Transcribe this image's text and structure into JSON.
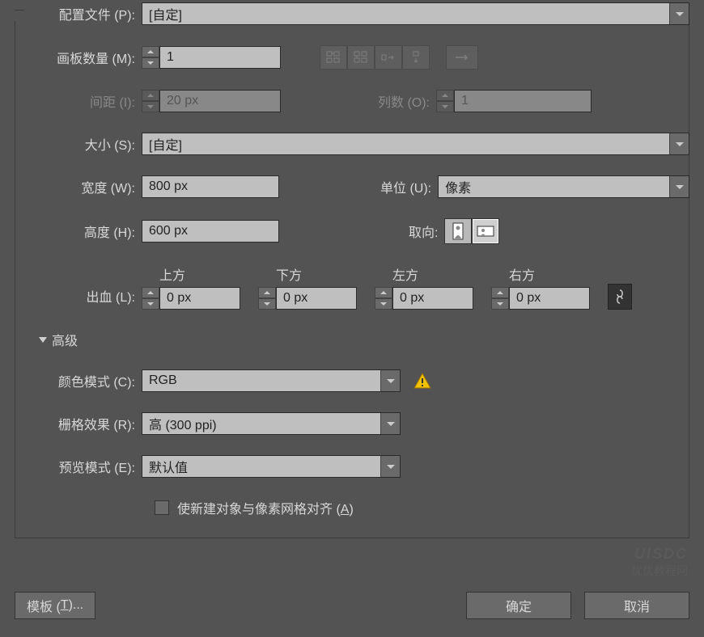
{
  "profile": {
    "label": "配置文件 (P):",
    "value": "[自定]"
  },
  "artboards": {
    "label": "画板数量 (M):",
    "value": "1"
  },
  "spacing": {
    "label": "间距 (I):",
    "value": "20 px"
  },
  "columns": {
    "label": "列数 (O):",
    "value": "1"
  },
  "size": {
    "label": "大小 (S):",
    "value": "[自定]"
  },
  "width": {
    "label": "宽度 (W):",
    "value": "800 px"
  },
  "units": {
    "label": "单位 (U):",
    "value": "像素"
  },
  "height": {
    "label": "高度 (H):",
    "value": "600 px"
  },
  "orientation": {
    "label": "取向:"
  },
  "bleed": {
    "label": "出血 (L):",
    "top": {
      "label": "上方",
      "value": "0 px"
    },
    "bottom": {
      "label": "下方",
      "value": "0 px"
    },
    "left": {
      "label": "左方",
      "value": "0 px"
    },
    "right": {
      "label": "右方",
      "value": "0 px"
    }
  },
  "advanced": {
    "label": "高级"
  },
  "colorMode": {
    "label": "颜色模式 (C):",
    "value": "RGB"
  },
  "rasterEffects": {
    "label": "栅格效果 (R):",
    "value": "高 (300 ppi)"
  },
  "previewMode": {
    "label": "预览模式 (E):",
    "value": "默认值"
  },
  "alignGrid": {
    "label_pre": "使新建对象与像素网格对齐 (",
    "label_key": "A",
    "label_post": ")"
  },
  "buttons": {
    "template_pre": "模板 (",
    "template_key": "T",
    "template_post": ")...",
    "ok": "确定",
    "cancel": "取消"
  },
  "watermark": {
    "line1": "UISDC",
    "line2": "优优教程网"
  }
}
